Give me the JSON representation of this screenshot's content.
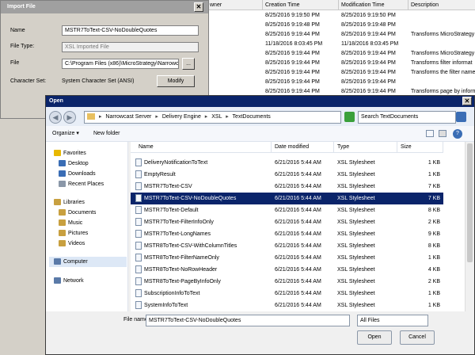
{
  "background_list": {
    "columns": [
      "wner",
      "Creation Time",
      "Modification Time",
      "Description"
    ],
    "rows": [
      {
        "created": "8/25/2016 9:19:50 PM",
        "modified": "8/25/2016 9:19:50 PM",
        "desc": ""
      },
      {
        "created": "8/25/2016 9:19:48 PM",
        "modified": "8/25/2016 9:19:48 PM",
        "desc": ""
      },
      {
        "created": "8/25/2016 9:19:44 PM",
        "modified": "8/25/2016 9:19:44 PM",
        "desc": "Transforms MicroStrategy"
      },
      {
        "created": "11/18/2016 8:03:45 PM",
        "modified": "11/18/2016 8:03:45 PM",
        "desc": ""
      },
      {
        "created": "8/25/2016 9:19:44 PM",
        "modified": "8/25/2016 9:19:44 PM",
        "desc": "Transforms MicroStrategy"
      },
      {
        "created": "8/25/2016 9:19:44 PM",
        "modified": "8/25/2016 9:19:44 PM",
        "desc": "Transforms filter informat"
      },
      {
        "created": "8/25/2016 9:19:44 PM",
        "modified": "8/25/2016 9:19:44 PM",
        "desc": "Transforms the filter name"
      },
      {
        "created": "8/25/2016 9:19:44 PM",
        "modified": "8/25/2016 9:19:44 PM",
        "desc": ""
      },
      {
        "created": "8/25/2016 9:19:44 PM",
        "modified": "8/25/2016 9:19:44 PM",
        "desc": "Transforms page by inform"
      }
    ]
  },
  "import_dialog": {
    "title": "Import File",
    "close": "✕",
    "name_label": "Name",
    "name_value": "MSTR7ToText-CSV-NoDoubleQuotes",
    "filetype_label": "File Type:",
    "filetype_value": "XSL Imported File",
    "file_label": "File",
    "file_value": "C:\\Program Files (x86)\\MicroStrategy\\Narrowc",
    "browse_label": "...",
    "charset_label": "Character Set:",
    "charset_value": "System Character Set (ANSI)",
    "modify_label": "Modify"
  },
  "open_dialog": {
    "title": "Open",
    "close": "✕",
    "back": "◀",
    "forward": "▶",
    "breadcrumb": [
      "Narrowcast Server",
      "Delivery Engine",
      "XSL",
      "TextDocuments"
    ],
    "sep": "▸",
    "search_placeholder": "Search TextDocuments",
    "organize_label": "Organize ▾",
    "new_folder_label": "New folder",
    "help": "?",
    "nav": [
      {
        "label": "Favorites",
        "color": "#e8b800"
      },
      {
        "label": "Desktop",
        "color": "#3a6db5"
      },
      {
        "label": "Downloads",
        "color": "#3a6db5"
      },
      {
        "label": "Recent Places",
        "color": "#8a97a8"
      },
      {
        "label": "Libraries",
        "color": "#c8a040"
      },
      {
        "label": "Documents",
        "color": "#c8a040"
      },
      {
        "label": "Music",
        "color": "#c8a040"
      },
      {
        "label": "Pictures",
        "color": "#c8a040"
      },
      {
        "label": "Videos",
        "color": "#c8a040"
      },
      {
        "label": "Computer",
        "color": "#5a7aa8"
      },
      {
        "label": "Network",
        "color": "#5a7aa8"
      }
    ],
    "columns": [
      "Name",
      "Date modified",
      "Type",
      "Size"
    ],
    "files": [
      {
        "name": "DeliveryNotificationToText",
        "date": "6/21/2016 5:44 AM",
        "type": "XSL Stylesheet",
        "size": "1 KB"
      },
      {
        "name": "EmptyResult",
        "date": "6/21/2016 5:44 AM",
        "type": "XSL Stylesheet",
        "size": "1 KB"
      },
      {
        "name": "MSTR7ToText-CSV",
        "date": "6/21/2016 5:44 AM",
        "type": "XSL Stylesheet",
        "size": "7 KB"
      },
      {
        "name": "MSTR7ToText-CSV-NoDoubleQuotes",
        "date": "6/21/2016 5:44 AM",
        "type": "XSL Stylesheet",
        "size": "7 KB",
        "selected": true
      },
      {
        "name": "MSTR7ToText-Default",
        "date": "6/21/2016 5:44 AM",
        "type": "XSL Stylesheet",
        "size": "8 KB"
      },
      {
        "name": "MSTR7ToText-FilterInfoOnly",
        "date": "6/21/2016 5:44 AM",
        "type": "XSL Stylesheet",
        "size": "2 KB"
      },
      {
        "name": "MSTR7ToText-LongNames",
        "date": "6/21/2016 5:44 AM",
        "type": "XSL Stylesheet",
        "size": "9 KB"
      },
      {
        "name": "MSTR8ToText-CSV-WithColumnTitles",
        "date": "6/21/2016 5:44 AM",
        "type": "XSL Stylesheet",
        "size": "8 KB"
      },
      {
        "name": "MSTR8ToText-FilterNameOnly",
        "date": "6/21/2016 5:44 AM",
        "type": "XSL Stylesheet",
        "size": "1 KB"
      },
      {
        "name": "MSTR8ToText-NoRowHeader",
        "date": "6/21/2016 5:44 AM",
        "type": "XSL Stylesheet",
        "size": "4 KB"
      },
      {
        "name": "MSTR8ToText-PageByInfoOnly",
        "date": "6/21/2016 5:44 AM",
        "type": "XSL Stylesheet",
        "size": "2 KB"
      },
      {
        "name": "SubscriptionInfoToText",
        "date": "6/21/2016 5:44 AM",
        "type": "XSL Stylesheet",
        "size": "1 KB"
      },
      {
        "name": "SystemInfoToText",
        "date": "6/21/2016 5:44 AM",
        "type": "XSL Stylesheet",
        "size": "1 KB"
      }
    ],
    "filename_label": "File name:",
    "filename_value": "MSTR7ToText-CSV-NoDoubleQuotes",
    "filter_value": "All Files",
    "open_label": "Open",
    "cancel_label": "Cancel"
  }
}
